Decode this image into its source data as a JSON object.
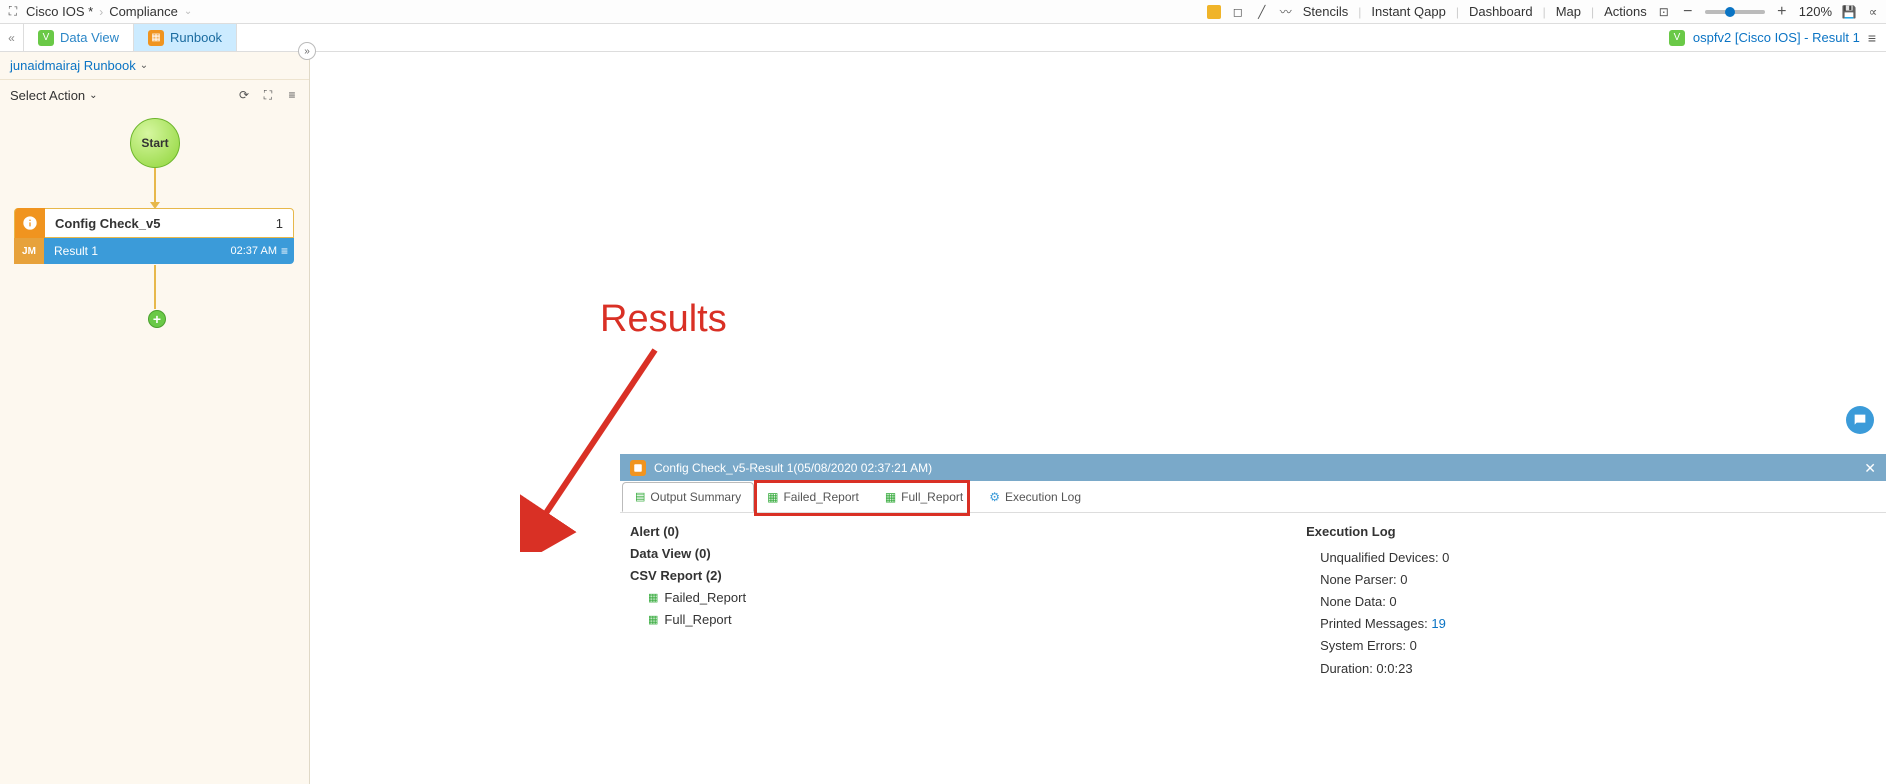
{
  "breadcrumb": {
    "item1": "Cisco IOS *",
    "item2": "Compliance"
  },
  "toolbar": {
    "stencils": "Stencils",
    "instant_qapp": "Instant Qapp",
    "dashboard": "Dashboard",
    "map": "Map",
    "actions": "Actions",
    "zoom": "120%"
  },
  "tabs": {
    "data_view": "Data View",
    "runbook": "Runbook"
  },
  "status_right": {
    "label": "ospfv2 [Cisco IOS] - Result 1"
  },
  "sidebar": {
    "header": "junaidmairaj Runbook",
    "select_action": "Select Action",
    "start": "Start",
    "config_block": {
      "title": "Config Check_v5",
      "count": "1"
    },
    "result_row": {
      "jm": "JM",
      "label": "Result 1",
      "time": "02:37 AM"
    }
  },
  "annotation": {
    "text": "Results"
  },
  "result_panel": {
    "title": "Config Check_v5-Result 1(05/08/2020 02:37:21 AM)",
    "tabs": {
      "output_summary": "Output Summary",
      "failed_report": "Failed_Report",
      "full_report": "Full_Report",
      "execution_log": "Execution Log"
    },
    "summary": {
      "alert": "Alert (0)",
      "data_view": "Data View (0)",
      "csv_report": "CSV Report (2)",
      "csv_items": [
        "Failed_Report",
        "Full_Report"
      ]
    },
    "exec_log": {
      "header": "Execution Log",
      "unqualified": "Unqualified Devices: 0",
      "none_parser": "None Parser: 0",
      "none_data": "None Data: 0",
      "printed_label": "Printed Messages: ",
      "printed_count": "19",
      "system_errors": "System Errors: 0",
      "duration": "Duration: 0:0:23"
    }
  }
}
